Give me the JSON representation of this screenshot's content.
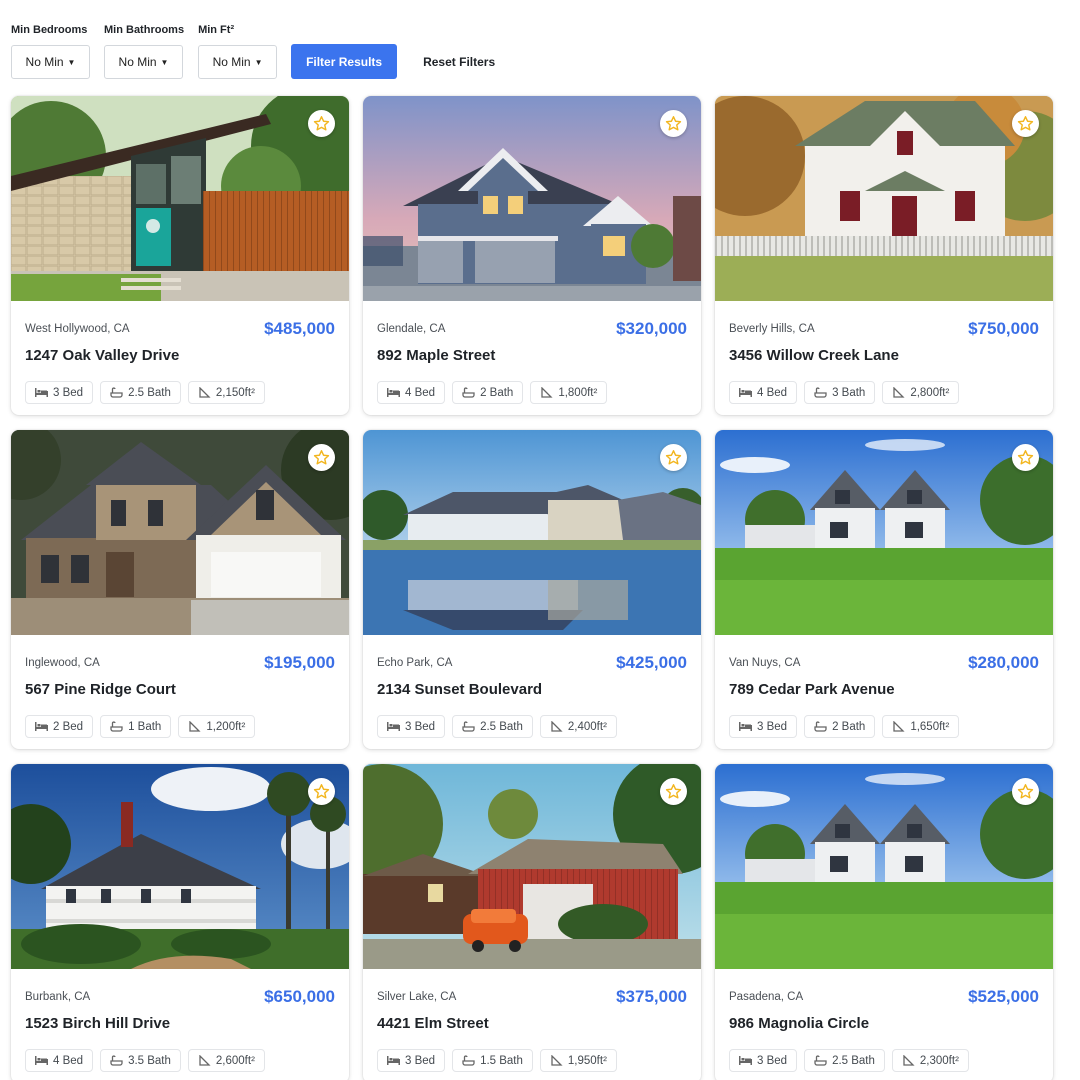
{
  "filters": {
    "bedrooms": {
      "label": "Min Bedrooms",
      "value": "No Min"
    },
    "bathrooms": {
      "label": "Min Bathrooms",
      "value": "No Min"
    },
    "area": {
      "label": "Min Ft²",
      "value": "No Min"
    },
    "filter_button": "Filter Results",
    "reset_button": "Reset Filters"
  },
  "colors": {
    "accent": "#3b74ee",
    "price": "#3b6fe6",
    "star": "#f2b51d"
  },
  "listings": [
    {
      "location": "West Hollywood, CA",
      "price": "$485,000",
      "address": "1247 Oak Valley Drive",
      "bed": "3 Bed",
      "bath": "2.5 Bath",
      "area": "2,150ft²"
    },
    {
      "location": "Glendale, CA",
      "price": "$320,000",
      "address": "892 Maple Street",
      "bed": "4 Bed",
      "bath": "2 Bath",
      "area": "1,800ft²"
    },
    {
      "location": "Beverly Hills, CA",
      "price": "$750,000",
      "address": "3456 Willow Creek Lane",
      "bed": "4 Bed",
      "bath": "3 Bath",
      "area": "2,800ft²"
    },
    {
      "location": "Inglewood, CA",
      "price": "$195,000",
      "address": "567 Pine Ridge Court",
      "bed": "2 Bed",
      "bath": "1 Bath",
      "area": "1,200ft²"
    },
    {
      "location": "Echo Park, CA",
      "price": "$425,000",
      "address": "2134 Sunset Boulevard",
      "bed": "3 Bed",
      "bath": "2.5 Bath",
      "area": "2,400ft²"
    },
    {
      "location": "Van Nuys, CA",
      "price": "$280,000",
      "address": "789 Cedar Park Avenue",
      "bed": "3 Bed",
      "bath": "2 Bath",
      "area": "1,650ft²"
    },
    {
      "location": "Burbank, CA",
      "price": "$650,000",
      "address": "1523 Birch Hill Drive",
      "bed": "4 Bed",
      "bath": "3.5 Bath",
      "area": "2,600ft²"
    },
    {
      "location": "Silver Lake, CA",
      "price": "$375,000",
      "address": "4421 Elm Street",
      "bed": "3 Bed",
      "bath": "1.5 Bath",
      "area": "1,950ft²"
    },
    {
      "location": "Pasadena, CA",
      "price": "$525,000",
      "address": "986 Magnolia Circle",
      "bed": "3 Bed",
      "bath": "2.5 Bath",
      "area": "2,300ft²"
    }
  ]
}
